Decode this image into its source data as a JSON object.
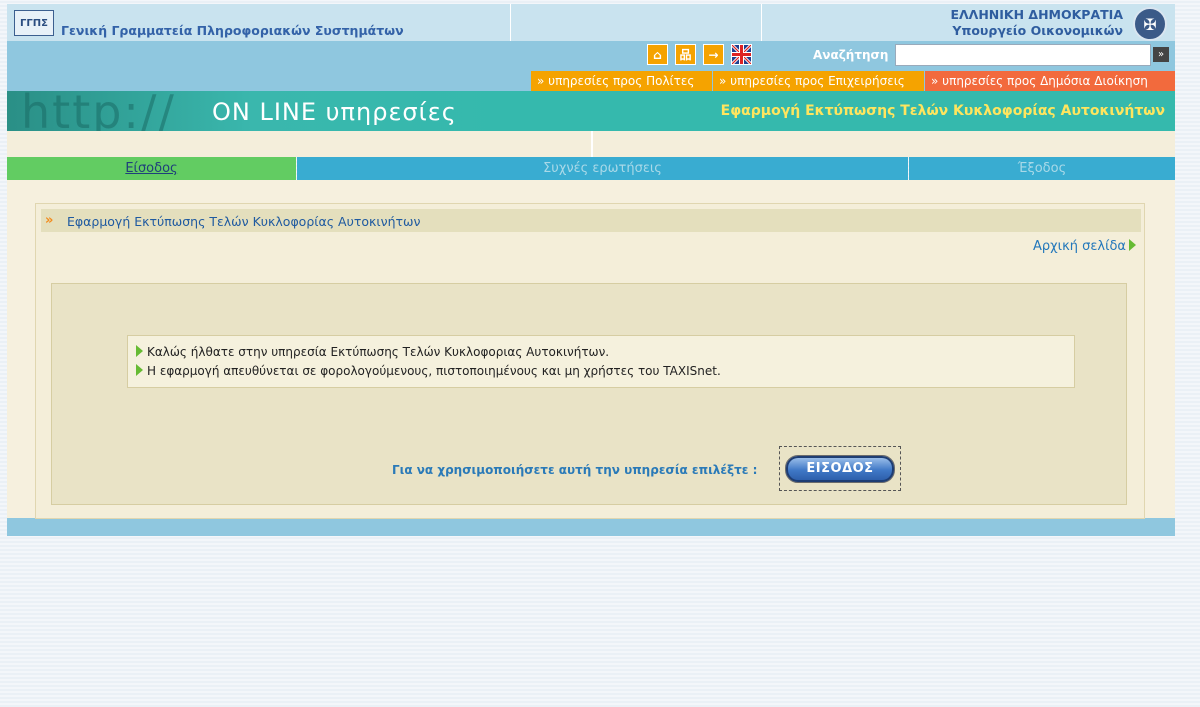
{
  "header": {
    "logo_text": "ΓΓΠΣ",
    "org_name": "Γενική Γραμματεία Πληροφοριακών Συστημάτων",
    "gov_line1": "ΕΛΛΗΝΙΚΗ ΔΗΜΟΚΡΑΤΙΑ",
    "gov_line2": "Υπουργείο Οικονομικών",
    "icons": [
      "home-icon",
      "sitemap-icon",
      "contact-icon",
      "english-flag-icon"
    ],
    "search_label": "Αναζήτηση",
    "search_value": "",
    "search_go": "»"
  },
  "services": [
    {
      "label": "»  υπηρεσίες προς Πολίτες",
      "color": "#f5a300"
    },
    {
      "label": "»  υπηρεσίες προς Επιχειρήσεις",
      "color": "#f5a300"
    },
    {
      "label": "»  υπηρεσίες προς Δημόσια Διοίκηση",
      "color": "#f26a3d"
    }
  ],
  "banner": {
    "http_text": "http://",
    "online_text": "ON LINE υπηρεσίες",
    "app_title": "Εφαρμογή Εκτύπωσης Τελών Κυκλοφορίας Αυτοκινήτων"
  },
  "nav": {
    "login": "Είσοδος",
    "faq": "Συχνές ερωτήσεις",
    "exit": "Έξοδος"
  },
  "panel": {
    "title": "Εφαρμογή Εκτύπωσης Τελών Κυκλοφορίας Αυτοκινήτων",
    "home_link": "Αρχική σελίδα",
    "messages": [
      "Καλώς ήλθατε στην υπηρεσία Εκτύπωσης Τελών Κυκλοφοριας Αυτοκινήτων.",
      "Η εφαρμογή απευθύνεται σε φορολογούμενους, πιστοποιημένους και μη χρήστες του TAXISnet."
    ],
    "prompt": "Για να χρησιμοποιήσετε αυτή την υπηρεσία επιλέξτε :",
    "enter_button": "ΕΙΣΟΔΟΣ"
  },
  "colors": {
    "accent_blue": "#39acd1",
    "accent_green": "#62cc62",
    "banner_teal": "#35b9ad",
    "title_yellow": "#ffe55e"
  }
}
